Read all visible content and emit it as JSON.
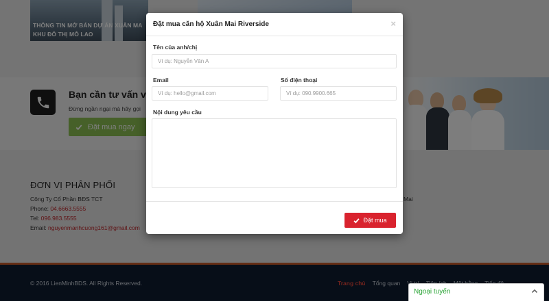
{
  "background": {
    "news_caption": "THÔNG TIN MỞ BÁN DỰ ÁN XUÂN MA KHU ĐÔ THỊ MỖ LAO",
    "consult_title": "Bạn cần tư vấn về",
    "consult_subtitle": "Đừng ngần ngại mà hãy gọi",
    "order_now_label": "Đặt mua ngay",
    "distributor": {
      "title": "ĐƠN VỊ PHÂN PHỐI",
      "company": "Công Ty Cổ Phần BĐS TCT",
      "phone_label": "Phone:",
      "phone": "04.6663.5555",
      "tel_label": "Tel:",
      "tel": "096.983.5555",
      "email_label": "Email:",
      "email": "nguyenmanhcuong161@gmail.com"
    },
    "partial_text": "Mai"
  },
  "footer": {
    "copyright": "© 2016 LienMinhBDS. All Rights Reserved.",
    "nav": [
      "Trang chủ",
      "Tổng quan",
      "Vị trí",
      "Tiện ích",
      "Mặt bằng",
      "Tiến độ"
    ]
  },
  "modal": {
    "title": "Đặt mua căn hộ Xuân Mai Riverside",
    "close": "×",
    "name_label": "Tên của anh/chị",
    "name_placeholder": "Ví dụ: Nguyễn Văn A",
    "email_label": "Email",
    "email_placeholder": "Ví dụ: hello@gmail.com",
    "phone_label": "Số điện thoại",
    "phone_placeholder": "Ví dụ: 090.9900.665",
    "message_label": "Nội dung yêu cầu",
    "submit_label": "Đặt mua"
  },
  "chat": {
    "status": "Ngoại tuyến"
  },
  "colors": {
    "accent_red": "#d9232e",
    "status_green": "#27a333",
    "footer_bg": "#0e1c30"
  },
  "icons": [
    "phone-icon",
    "check-icon",
    "close-icon",
    "chevron-up-icon"
  ]
}
